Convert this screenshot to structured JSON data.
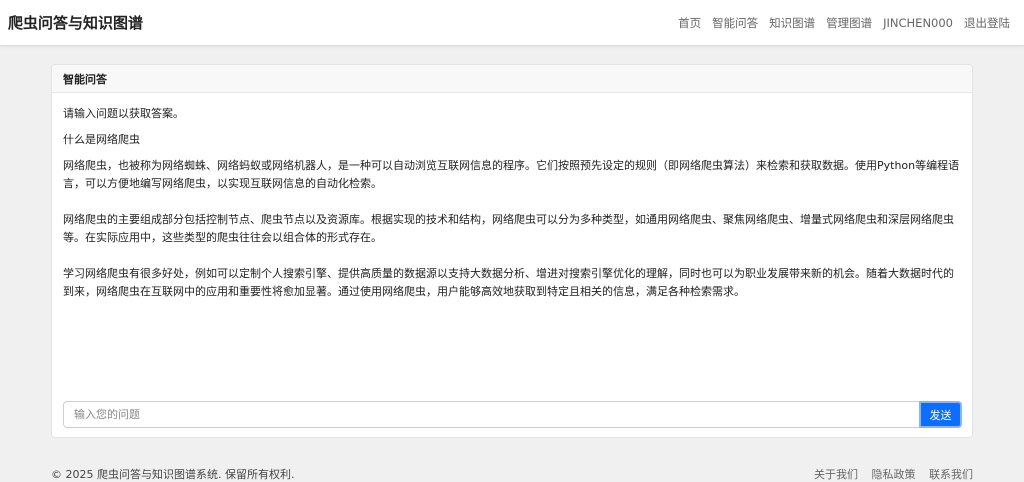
{
  "navbar": {
    "brand": "爬虫问答与知识图谱",
    "links": [
      "首页",
      "智能问答",
      "知识图谱",
      "管理图谱",
      "JINCHEN000",
      "退出登陆"
    ]
  },
  "card": {
    "title": "智能问答",
    "system_prompt": "请输入问题以获取答案。",
    "user_question": "什么是网络爬虫",
    "answer_paragraphs": [
      "网络爬虫，也被称为网络蜘蛛、网络蚂蚁或网络机器人，是一种可以自动浏览互联网信息的程序。它们按照预先设定的规则（即网络爬虫算法）来检索和获取数据。使用Python等编程语言，可以方便地编写网络爬虫，以实现互联网信息的自动化检索。",
      "网络爬虫的主要组成部分包括控制节点、爬虫节点以及资源库。根据实现的技术和结构，网络爬虫可以分为多种类型，如通用网络爬虫、聚焦网络爬虫、增量式网络爬虫和深层网络爬虫等。在实际应用中，这些类型的爬虫往往会以组合体的形式存在。",
      "学习网络爬虫有很多好处，例如可以定制个人搜索引擎、提供高质量的数据源以支持大数据分析、增进对搜索引擎优化的理解，同时也可以为职业发展带来新的机会。随着大数据时代的到来，网络爬虫在互联网中的应用和重要性将愈加显著。通过使用网络爬虫，用户能够高效地获取到特定且相关的信息，满足各种检索需求。"
    ],
    "input_placeholder": "输入您的问题",
    "send_label": "发送"
  },
  "footer": {
    "copyright": "© 2025 爬虫问答与知识图谱系统. 保留所有权利.",
    "links": [
      "关于我们",
      "隐私政策",
      "联系我们"
    ]
  }
}
